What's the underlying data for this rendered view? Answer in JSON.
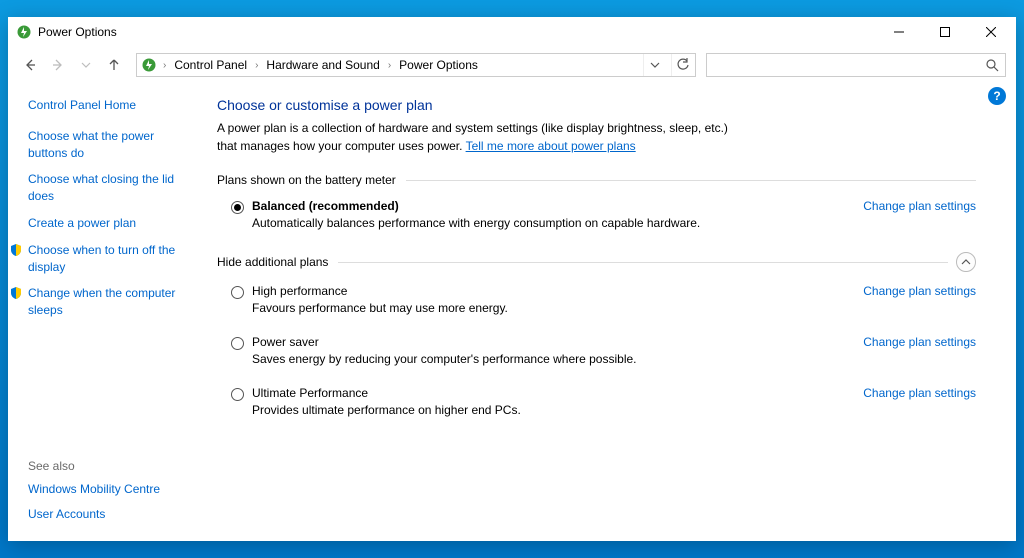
{
  "window": {
    "title": "Power Options"
  },
  "breadcrumb": {
    "items": [
      "Control Panel",
      "Hardware and Sound",
      "Power Options"
    ]
  },
  "search": {
    "placeholder": ""
  },
  "sidebar": {
    "home": "Control Panel Home",
    "tasks": [
      {
        "label": "Choose what the power buttons do",
        "icon": null
      },
      {
        "label": "Choose what closing the lid does",
        "icon": null
      },
      {
        "label": "Create a power plan",
        "icon": null
      },
      {
        "label": "Choose when to turn off the display",
        "icon": "shield"
      },
      {
        "label": "Change when the computer sleeps",
        "icon": "shield"
      }
    ],
    "seealso_header": "See also",
    "seealso": [
      "Windows Mobility Centre",
      "User Accounts"
    ]
  },
  "main": {
    "heading": "Choose or customise a power plan",
    "description": "A power plan is a collection of hardware and system settings (like display brightness, sleep, etc.) that manages how your computer uses power. ",
    "description_link": "Tell me more about power plans",
    "section1": "Plans shown on the battery meter",
    "section2": "Hide additional plans",
    "change_link": "Change plan settings",
    "plans_primary": [
      {
        "name": "Balanced (recommended)",
        "selected": true,
        "desc": "Automatically balances performance with energy consumption on capable hardware."
      }
    ],
    "plans_additional": [
      {
        "name": "High performance",
        "selected": false,
        "desc": "Favours performance but may use more energy."
      },
      {
        "name": "Power saver",
        "selected": false,
        "desc": "Saves energy by reducing your computer's performance where possible."
      },
      {
        "name": "Ultimate Performance",
        "selected": false,
        "desc": "Provides ultimate performance on higher end PCs."
      }
    ]
  }
}
